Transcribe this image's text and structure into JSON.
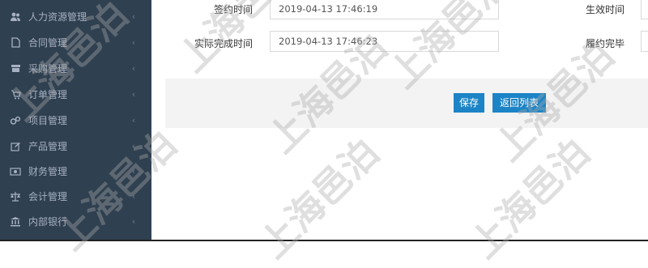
{
  "sidebar": {
    "items": [
      {
        "label": "人力资源管理",
        "icon": "users-icon"
      },
      {
        "label": "合同管理",
        "icon": "file-icon"
      },
      {
        "label": "采购管理",
        "icon": "cart-box-icon"
      },
      {
        "label": "订单管理",
        "icon": "cart-icon"
      },
      {
        "label": "项目管理",
        "icon": "gears-icon"
      },
      {
        "label": "产品管理",
        "icon": "edit-icon"
      },
      {
        "label": "财务管理",
        "icon": "money-icon"
      },
      {
        "label": "会计管理",
        "icon": "balance-icon"
      },
      {
        "label": "内部银行",
        "icon": "bank-icon"
      }
    ],
    "arrow": "‹"
  },
  "form": {
    "sign_time_label": "签约时间",
    "sign_time_value": "2019-04-13 17:46:19",
    "effective_time_label": "生效时间",
    "actual_finish_label": "实际完成时间",
    "actual_finish_value": "2019-04-13 17:46:23",
    "fulfilled_label": "履约完毕"
  },
  "actions": {
    "save_label": "保存",
    "back_label": "返回列表"
  },
  "watermark": "上海邑泊",
  "colors": {
    "sidebar_bg": "#2f4050",
    "sidebar_text": "#a7b1c2",
    "primary_button": "#1c84c6",
    "action_bar_bg": "#f3f3f4"
  }
}
